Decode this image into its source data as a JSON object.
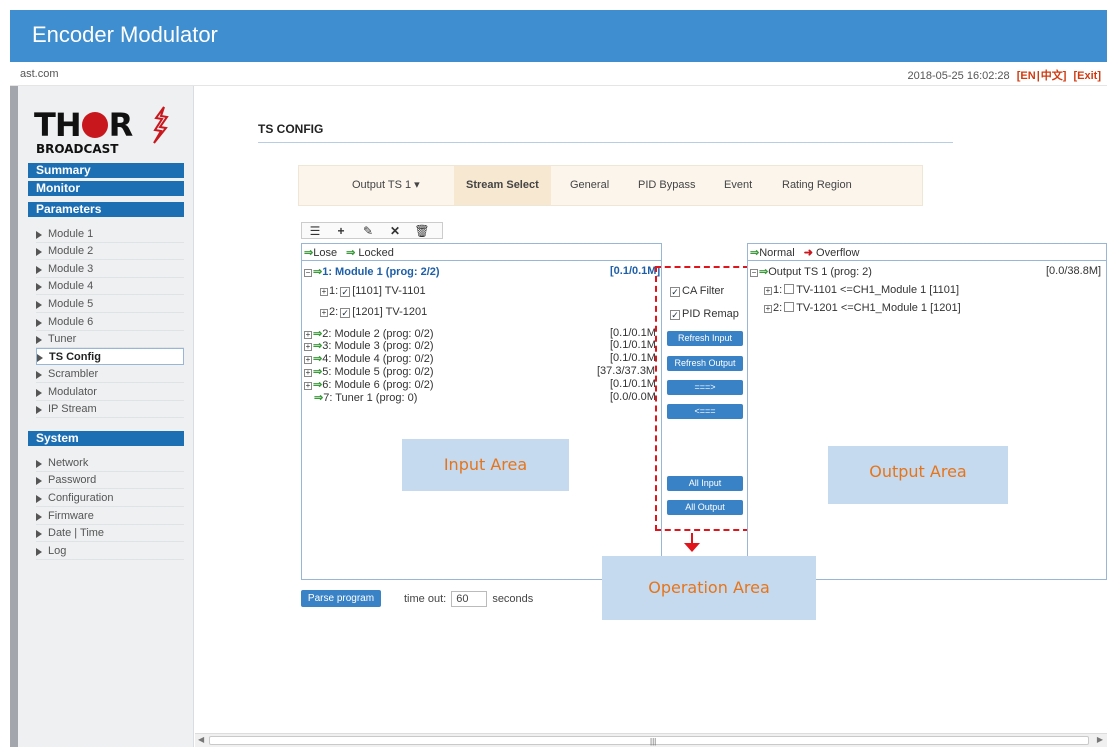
{
  "header": {
    "title": "Encoder Modulator"
  },
  "subbar": {
    "host": "ast.com",
    "datetime": "2018-05-25 16:02:28",
    "lang_en": "[EN",
    "lang_sep": "|",
    "lang_zh": "中文]",
    "exit": "[Exit]"
  },
  "logo": {
    "brand_a": "TH",
    "brand_b": "R",
    "sub": "BROADCAST"
  },
  "nav": {
    "summary": "Summary",
    "monitor": "Monitor",
    "parameters": "Parameters",
    "param_items": [
      "Module 1",
      "Module 2",
      "Module 3",
      "Module 4",
      "Module 5",
      "Module 6",
      "Tuner",
      "TS Config",
      "Scrambler",
      "Modulator",
      "IP Stream"
    ],
    "system": "System",
    "system_items": [
      "Network",
      "Password",
      "Configuration",
      "Firmware",
      "Date | Time",
      "Log"
    ]
  },
  "page": {
    "title": "TS CONFIG"
  },
  "tabs": [
    "Output TS 1 ▾",
    "Stream Select",
    "General",
    "PID Bypass",
    "Event",
    "Rating Region"
  ],
  "toolbar_icons": [
    "list-icon",
    "add-icon",
    "edit-icon",
    "delete-icon",
    "trash-icon"
  ],
  "input": {
    "legend_lose": "Lose",
    "legend_locked": "Locked",
    "modules": [
      {
        "label": "1: Module 1 (prog: 2/2)",
        "rate": "[0.1/0.1M]"
      },
      {
        "label": "2: Module 2 (prog: 0/2)",
        "rate": "[0.1/0.1M"
      },
      {
        "label": "3: Module 3 (prog: 0/2)",
        "rate": "[0.1/0.1M"
      },
      {
        "label": "4: Module 4 (prog: 0/2)",
        "rate": "[0.1/0.1M"
      },
      {
        "label": "5: Module 5 (prog: 0/2)",
        "rate": "[37.3/37.3M"
      },
      {
        "label": "6: Module 6 (prog: 0/2)",
        "rate": "[0.1/0.1M"
      },
      {
        "label": "7: Tuner 1 (prog: 0)",
        "rate": "[0.0/0.0M"
      }
    ],
    "programs": [
      {
        "num": "1:",
        "label": "[1101] TV-1101"
      },
      {
        "num": "2:",
        "label": "[1201] TV-1201"
      }
    ]
  },
  "ops": {
    "ca_filter": "CA Filter",
    "pid_remap": "PID Remap",
    "refresh_input": "Refresh Input",
    "refresh_output": "Refresh Output",
    "move_right": "===>",
    "move_left": "<===",
    "all_input": "All Input",
    "all_output": "All Output"
  },
  "output": {
    "legend_normal": "Normal",
    "legend_overflow": "Overflow",
    "ts_label": "Output TS 1 (prog: 2)",
    "ts_rate": "[0.0/38.8M]",
    "programs": [
      {
        "num": "1:",
        "label": "TV-1101 <=CH1_Module 1 [1101]"
      },
      {
        "num": "2:",
        "label": "TV-1201 <=CH1_Module 1 [1201]"
      }
    ]
  },
  "annotations": {
    "input_area": "Input Area",
    "output_area": "Output Area",
    "operation_area": "Operation Area"
  },
  "bottom": {
    "parse_button": "Parse program",
    "timeout_label": "time out:",
    "timeout_value": "60",
    "timeout_unit": "seconds"
  }
}
